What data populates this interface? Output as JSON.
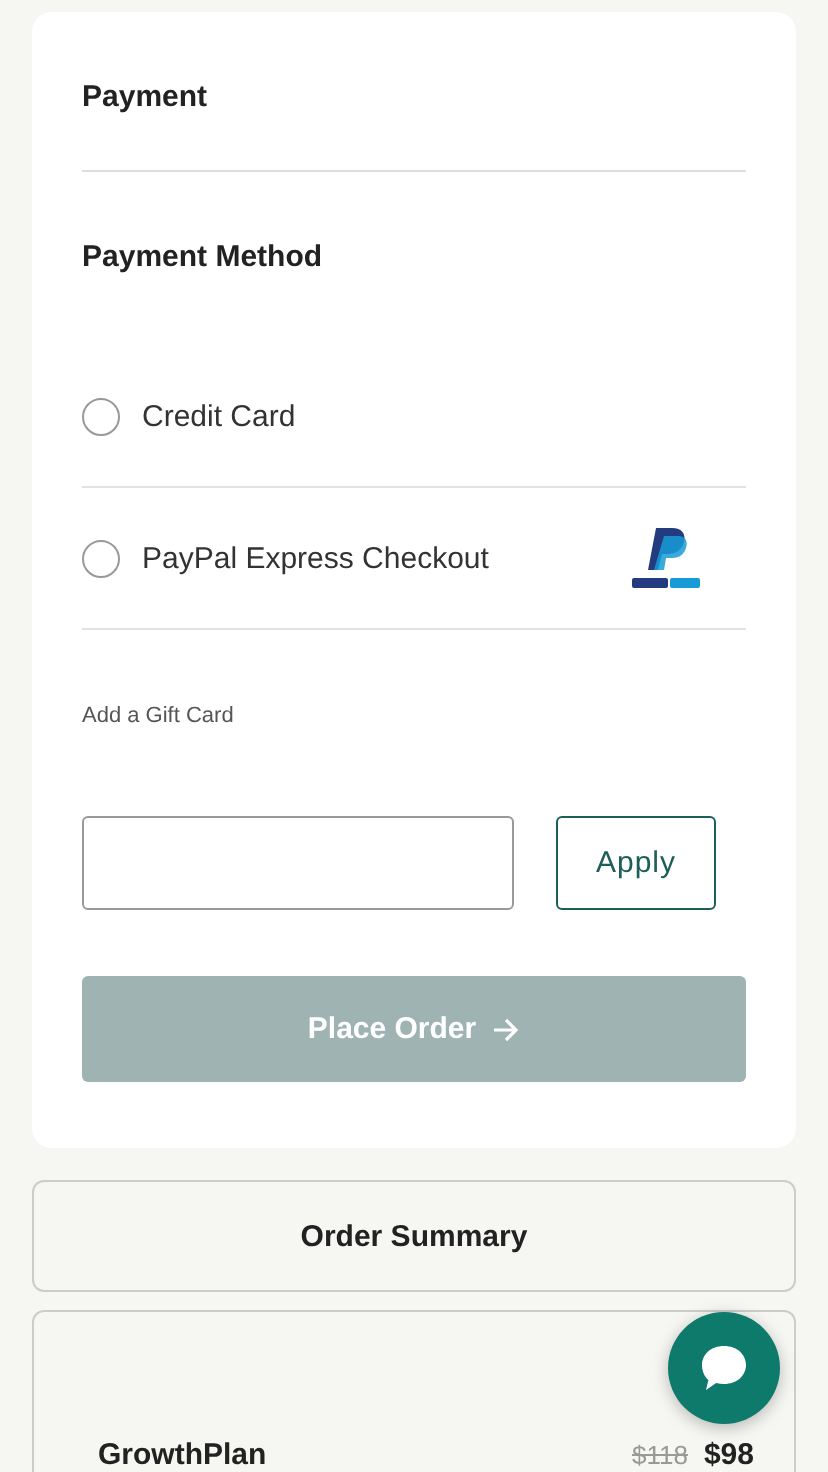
{
  "payment": {
    "title": "Payment",
    "method_title": "Payment Method",
    "methods": [
      {
        "label": "Credit Card",
        "selected": false,
        "logo": false
      },
      {
        "label": "PayPal Express Checkout",
        "selected": false,
        "logo": true
      }
    ],
    "gift_card": {
      "label": "Add a Gift Card",
      "button": "Apply"
    },
    "place_order": {
      "label": "Place Order",
      "disabled": true
    }
  },
  "order_summary": {
    "title": "Order Summary",
    "items": [
      {
        "name": "GrowthPlan",
        "old_price": "$118",
        "price": "$98"
      }
    ]
  }
}
